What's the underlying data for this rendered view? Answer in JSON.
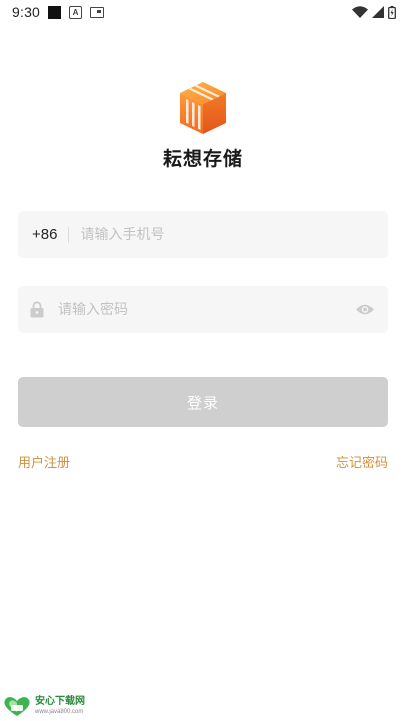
{
  "status_bar": {
    "time": "9:30",
    "icons": [
      "notification-square-icon",
      "a-badge-icon",
      "card-icon",
      "wifi-icon",
      "signal-icon",
      "battery-charging-icon"
    ]
  },
  "app": {
    "name": "耘想存储",
    "logo_icon": "storage-box-icon"
  },
  "phone_field": {
    "country_code": "+86",
    "placeholder": "请输入手机号",
    "value": ""
  },
  "password_field": {
    "placeholder": "请输入密码",
    "value": "",
    "leading_icon": "lock-icon",
    "trailing_icon": "eye-icon"
  },
  "login_button": {
    "label": "登录"
  },
  "links": {
    "register": "用户注册",
    "forgot_password": "忘记密码"
  },
  "watermark": {
    "title": "安心下载网",
    "url": "www.java800.com"
  },
  "colors": {
    "accent": "#d4903b",
    "logo_orange": "#f07a2a",
    "button_disabled": "#cfcfcf",
    "field_background": "#f6f6f6"
  }
}
